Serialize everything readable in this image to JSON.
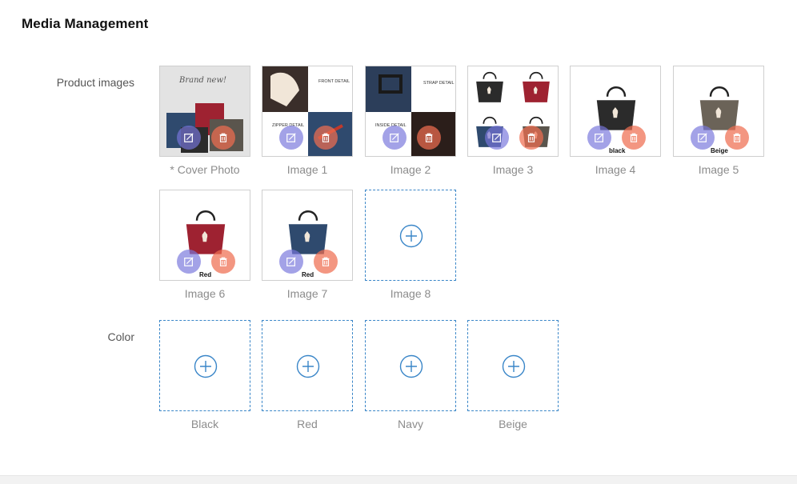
{
  "section_title": "Media Management",
  "product_images": {
    "label": "Product images",
    "tiles": [
      {
        "caption": "* Cover Photo",
        "filled": true,
        "overlay_text": "Brand new!"
      },
      {
        "caption": "Image  1",
        "filled": true,
        "overlay_text": "FRONT DETAIL",
        "overlay_text2": "ZIPPER DETAIL"
      },
      {
        "caption": "Image  2",
        "filled": true,
        "overlay_text": "STRAP DETAIL",
        "overlay_text2": "INSIDE DETAIL"
      },
      {
        "caption": "Image  3",
        "filled": true
      },
      {
        "caption": "Image  4",
        "filled": true,
        "bag_label": "black",
        "bag_color": "#2b2b2b"
      },
      {
        "caption": "Image  5",
        "filled": true,
        "bag_label": "Beige",
        "bag_color": "#6b6358"
      },
      {
        "caption": "Image  6",
        "filled": true,
        "bag_label": "Red",
        "bag_color": "#9e2231"
      },
      {
        "caption": "Image  7",
        "filled": true,
        "bag_label": "Red",
        "bag_color": "#2f4a6e"
      },
      {
        "caption": "Image  8",
        "filled": false
      }
    ]
  },
  "color": {
    "label": "Color",
    "tiles": [
      {
        "caption": "Black"
      },
      {
        "caption": "Red"
      },
      {
        "caption": "Navy"
      },
      {
        "caption": "Beige"
      }
    ]
  },
  "colors": {
    "accent": "#3a86c8",
    "edit_button": "#7876dc",
    "delete_button": "#ee6e50"
  },
  "icons": {
    "edit": "edit-icon",
    "delete": "trash-icon",
    "add": "plus-circle-icon"
  }
}
